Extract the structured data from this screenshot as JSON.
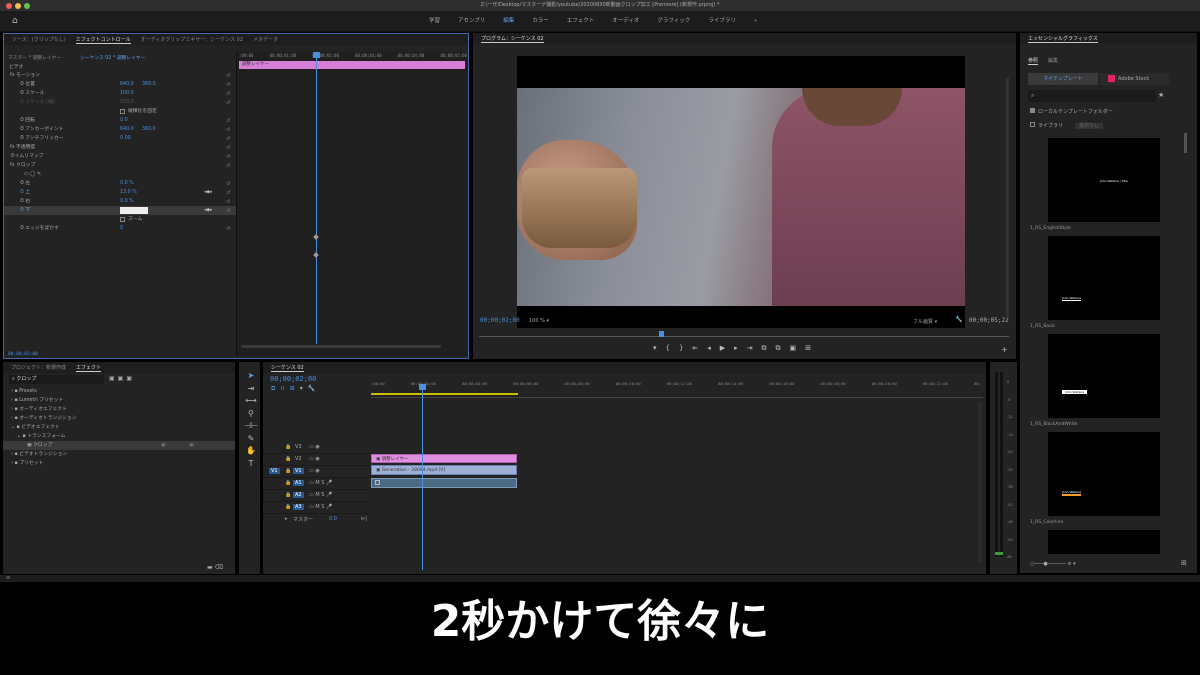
{
  "window_title": "Z:\\ーザ/Desktop/マスターゲ撮影/youtube/20200830新動画クロップ加工 [Premiere] (新規作.prproj) *",
  "workspaces": [
    "学習",
    "アセンブリ",
    "編集",
    "カラー",
    "エフェクト",
    "オーディオ",
    "グラフィック",
    "ライブラリ",
    "»"
  ],
  "active_workspace": "編集",
  "source_panel": {
    "tabs": [
      "ソース：(クリップなし)",
      "エフェクトコントロール",
      "オーディオクリップミキサー：シーケンス 02",
      "メタデータ"
    ],
    "subtabs": [
      "マスター * 調整レイヤー",
      "シーケンス 02 * 調整レイヤー"
    ],
    "ruler": [
      ":00:00",
      "00;00;01;00",
      "00;00;02;00",
      "00;00;03;00",
      "00;00;04;00",
      "00;00;05;00"
    ],
    "clip_label": "調整レイヤー",
    "section": "ビデオ",
    "rows": [
      {
        "label": "fx モーション",
        "v1": "",
        "v2": ""
      },
      {
        "label": "位置",
        "v1": "640.0",
        "v2": "360.0"
      },
      {
        "label": "スケール",
        "v1": "100.0",
        "v2": ""
      },
      {
        "label": "スケール (幅)",
        "v1": "100.0",
        "v2": ""
      },
      {
        "label": "縦横比を固定",
        "v1": "",
        "v2": ""
      },
      {
        "label": "回転",
        "v1": "0.0",
        "v2": ""
      },
      {
        "label": "アンカーポイント",
        "v1": "640.0",
        "v2": "360.0"
      },
      {
        "label": "アンチフリッカー",
        "v1": "0.00",
        "v2": ""
      },
      {
        "label": "fx 不透明度",
        "v1": "",
        "v2": ""
      },
      {
        "label": "タイムリマップ",
        "v1": "",
        "v2": ""
      },
      {
        "label": "fx クロップ",
        "v1": "",
        "v2": ""
      },
      {
        "label": "",
        "v1": "",
        "v2": ""
      },
      {
        "label": "左",
        "v1": "0.0 %",
        "v2": ""
      },
      {
        "label": "上",
        "v1": "13.0 %",
        "v2": ""
      },
      {
        "label": "右",
        "v1": "0.0 %",
        "v2": ""
      },
      {
        "label": "下",
        "v1": "",
        "v2": ""
      },
      {
        "label": "ズーム",
        "v1": "",
        "v2": ""
      },
      {
        "label": "エッジをぼかす",
        "v1": "0",
        "v2": ""
      }
    ],
    "timecode": "00;00;02;00"
  },
  "program_panel": {
    "tab": "プログラム：シーケンス 02",
    "timecode": "00;00;02;00",
    "zoom": "100 %",
    "fit": "フル画質",
    "duration": "00;00;05;22"
  },
  "essential": {
    "title": "エッセンシャルグラフィックス",
    "tabs": [
      "参照",
      "編集"
    ],
    "my_templates": "マイテンプレート",
    "adobe_stock": "Adobe Stock",
    "local_folder": "ローカルテンプレートフォルダー",
    "library": "ライブラリ",
    "library_value": "選択なし",
    "templates": [
      {
        "name": "1_RS_EnglishStyle",
        "text": "John Wallace / title"
      },
      {
        "name": "1_RS_Basic",
        "text": "John Wallace"
      },
      {
        "name": "1_RS_BlackAndWhite",
        "text": "John Wallace"
      },
      {
        "name": "1_RS_Colorline",
        "text": "John Wallace"
      }
    ]
  },
  "project_panel": {
    "tabs": [
      "プロジェクト：新規作成",
      "エフェクト"
    ],
    "search": "クロップ",
    "tree": [
      "Presets",
      "Lumetri プリセット",
      "オーディオエフェクト",
      "オーディオトランジション",
      "ビデオエフェクト",
      "トランスフォーム",
      "クロップ",
      "ビデオトランジション",
      "プリセット"
    ]
  },
  "timeline": {
    "tab": "シーケンス 02",
    "timecode": "00;00;02;00",
    "ruler": [
      ";00;00",
      "00;00;02;00",
      "00;00;04;00",
      "00;00;06;00",
      "00;00;08;00",
      "00;00;10;00",
      "00;00;12;00",
      "00;00;14;00",
      "00;00;16;00",
      "00;00;18;00",
      "00;00;20;00",
      "00;00;22;00",
      "00;"
    ],
    "tracks": [
      "V3",
      "V2",
      "V1",
      "A1",
      "A2",
      "A3"
    ],
    "master_label": "マスター",
    "master_value": "0.0",
    "clip_adjust": "調整レイヤー",
    "clip_video": "Generation - 28094.mp4 [V]"
  },
  "meter_scale": [
    "0",
    "-6",
    "-12",
    "-18",
    "-24",
    "-30",
    "-36",
    "-42",
    "-48",
    "-54",
    "dB"
  ],
  "subtitle": "2秒かけて徐々に"
}
